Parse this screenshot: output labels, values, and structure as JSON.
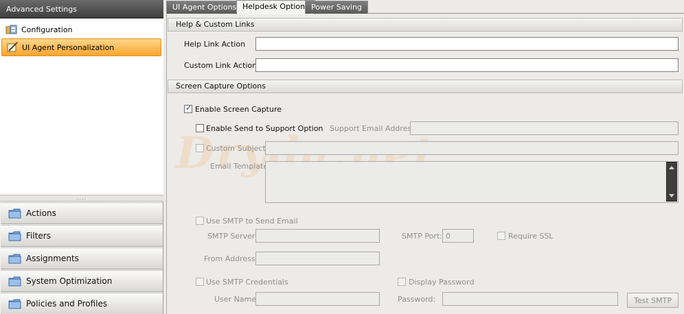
{
  "sidebar": {
    "header": "Advanced Settings",
    "tree": [
      {
        "label": "Configuration",
        "icon": "configuration-icon",
        "selected": false
      },
      {
        "label": "UI Agent Personalization",
        "icon": "personalization-icon",
        "selected": true
      }
    ],
    "splitter": "....",
    "nav": [
      {
        "label": "Actions",
        "icon": "folder-icon"
      },
      {
        "label": "Filters",
        "icon": "folder-icon"
      },
      {
        "label": "Assignments",
        "icon": "folder-icon"
      },
      {
        "label": "System Optimization",
        "icon": "folder-icon"
      },
      {
        "label": "Policies and Profiles",
        "icon": "folder-icon"
      }
    ]
  },
  "tabs": [
    {
      "label": "UI Agent Options",
      "active": false
    },
    {
      "label": "Helpdesk Options",
      "active": true
    },
    {
      "label": "Power Saving",
      "active": false
    }
  ],
  "help_links": {
    "title": "Help & Custom Links",
    "help_link_label": "Help Link Action",
    "help_link_value": "",
    "custom_link_label": "Custom Link Action",
    "custom_link_value": ""
  },
  "screen_capture": {
    "title": "Screen Capture Options",
    "enable_label": "Enable Screen Capture",
    "enable_checked": true,
    "send_support_label": "Enable Send to Support Option",
    "send_support_checked": false,
    "support_email_label": "Support Email Address:",
    "support_email_value": "",
    "custom_subject_label": "Custom Subject:",
    "custom_subject_value": "",
    "email_template_label": "Email Template:",
    "email_template_value": ""
  },
  "smtp": {
    "use_smtp_label": "Use SMTP to Send Email",
    "server_label": "SMTP Server:",
    "server_value": "",
    "port_label": "SMTP Port:",
    "port_value": "0",
    "require_ssl_label": "Require SSL",
    "from_label": "From Address:",
    "from_value": "",
    "use_credentials_label": "Use SMTP Credentials",
    "display_password_label": "Display Password",
    "username_label": "User Name:",
    "username_value": "",
    "password_label": "Password:",
    "password_value": "",
    "test_button": "Test SMTP"
  },
  "watermark": "Dryda.net",
  "colors": {
    "selected_item": "#f7a52f",
    "header_dark": "#3e3e3e",
    "checkbox_tick": "#1e3d8f"
  }
}
